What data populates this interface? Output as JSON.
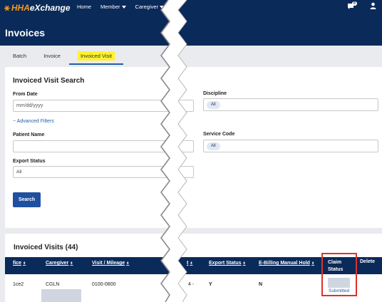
{
  "brand": {
    "hha": "HHA",
    "exchange": "eXchange"
  },
  "nav": {
    "items": [
      {
        "label": "Home",
        "dropdown": false
      },
      {
        "label": "Member",
        "dropdown": true
      },
      {
        "label": "Caregiver",
        "dropdown": true
      },
      {
        "label": "Vis",
        "dropdown": false
      }
    ],
    "chat_badge": "0"
  },
  "page": {
    "title": "Invoices"
  },
  "tabs": [
    {
      "label": "Batch",
      "active": false
    },
    {
      "label": "Invoice",
      "active": false
    },
    {
      "label": "Invoiced Visit",
      "active": true
    }
  ],
  "search": {
    "title": "Invoiced Visit Search",
    "from_date_label": "From Date",
    "from_date_placeholder": "mm/dd/yyyy",
    "advanced_filters": "− Advanced Filters",
    "patient_name_label": "Patient Name",
    "patient_name_value": "",
    "export_status_label": "Export Status",
    "export_status_value": "All",
    "discipline_label": "Discipline",
    "discipline_value": "All",
    "service_code_label": "Service Code",
    "service_code_value": "All",
    "search_button": "Search"
  },
  "results": {
    "title": "Invoiced Visits (44)",
    "columns": {
      "office": "fice",
      "caregiver": "Caregiver",
      "visit_mileage": "Visit / Mileage",
      "invoice": "t",
      "export_status": "Export Status",
      "ebilling_hold": "E-Billing Manual Hold",
      "claim_status_line1": "Claim",
      "claim_status_line2": "Status",
      "delete": "Delete"
    },
    "rows": [
      {
        "office": "1ce2",
        "caregiver": "CGLN",
        "visit_mileage": "0100-0800",
        "invoice_prefix": "0",
        "invoice_suffix": "4 -",
        "export_status": "Y",
        "ebilling_hold": "N",
        "claim_status": "Submitted"
      }
    ]
  },
  "colors": {
    "navy": "#0a2a59",
    "accent_orange": "#f39a1e",
    "tab_highlight": "#fff22e",
    "button_blue": "#1f4fa0",
    "highlight_red": "#d9342b"
  }
}
